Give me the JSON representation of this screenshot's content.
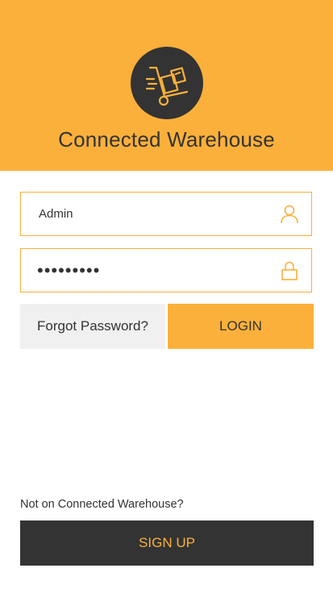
{
  "app": {
    "title": "Connected Warehouse",
    "logo_icon": "hand-truck-icon"
  },
  "login_form": {
    "username": {
      "value": "Admin",
      "icon": "user-icon"
    },
    "password": {
      "value": "•••••••••",
      "icon": "lock-icon"
    },
    "forgot_label": "Forgot Password?",
    "login_label": "LOGIN"
  },
  "signup": {
    "prompt": "Not on Connected Warehouse?",
    "button_label": "SIGN UP"
  },
  "colors": {
    "accent": "#fbb03b",
    "dark": "#333333",
    "muted": "#f0f0f0"
  }
}
